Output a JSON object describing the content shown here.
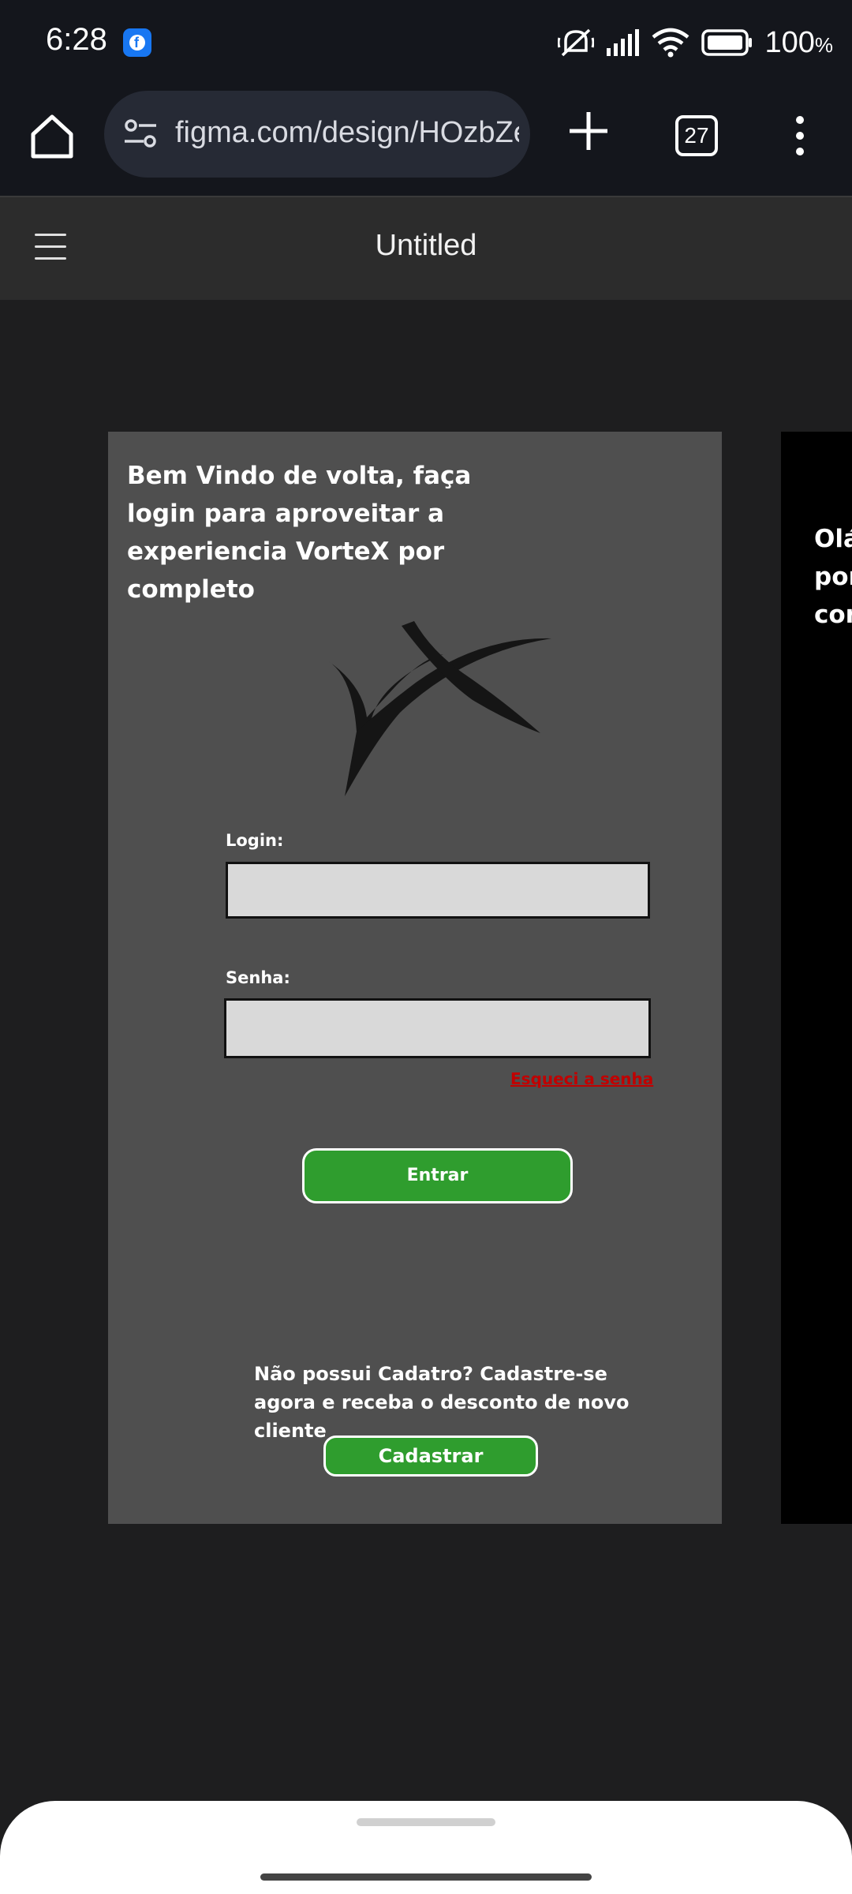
{
  "status_bar": {
    "time": "6:28",
    "battery": "100",
    "battery_unit": "%",
    "icons": [
      "facebook-icon",
      "mute-icon",
      "signal-icon",
      "wifi-icon",
      "battery-icon"
    ]
  },
  "browser": {
    "url": "figma.com/design/HOzbZe",
    "tab_count": "27",
    "icons": [
      "home-icon",
      "site-settings-icon",
      "new-tab-icon",
      "tabs-icon",
      "more-menu-icon"
    ]
  },
  "figma": {
    "title": "Untitled",
    "icons": [
      "hamburger-menu-icon"
    ]
  },
  "login_frame": {
    "welcome": "Bem Vindo de volta, faça login para aproveitar a experiencia VorteX por completo",
    "login_label": "Login:",
    "password_label": "Senha:",
    "forgot_password": "Esqueci a senha",
    "enter_button": "Entrar",
    "signup_text": "Não possui Cadatro? Cadastre-se agora e receba o desconto de novo cliente",
    "signup_button": "Cadastrar",
    "colors": {
      "frame_bg": "#4f4f4f",
      "button_green": "#2f9d2e",
      "link_red": "#c10000",
      "field_bg": "#d9d9d9"
    }
  },
  "second_frame": {
    "lines": [
      "Olá",
      "por",
      "cor"
    ]
  }
}
